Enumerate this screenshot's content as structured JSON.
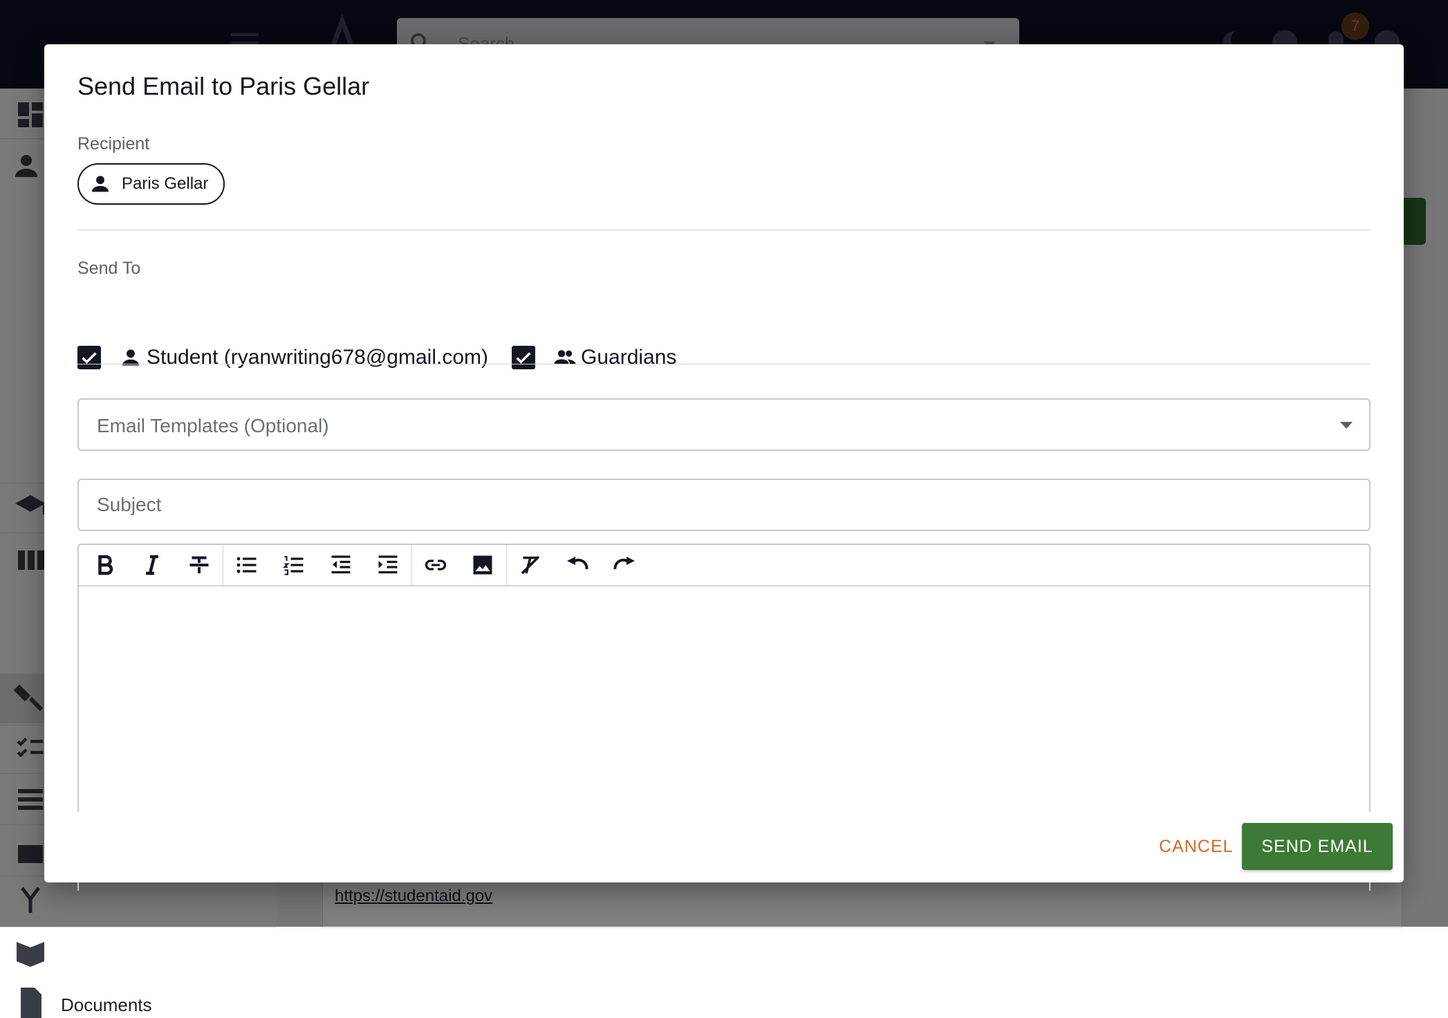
{
  "background": {
    "search_placeholder": "Search",
    "notification_count": "7",
    "sidebar_label": "Documents",
    "content_link": "https://studentaid.gov"
  },
  "modal": {
    "title": "Send Email to Paris Gellar",
    "recipient_label": "Recipient",
    "recipient_chip": "Paris Gellar",
    "send_to_label": "Send To",
    "student_option": "Student (ryanwriting678@gmail.com)",
    "guardians_option": "Guardians",
    "student_checked": true,
    "guardians_checked": true,
    "template_placeholder": "Email Templates (Optional)",
    "subject_placeholder": "Subject",
    "cancel_label": "CANCEL",
    "send_label": "SEND EMAIL"
  },
  "toolbar_icons": [
    "bold-icon",
    "italic-icon",
    "strikethrough-icon",
    "bullet-list-icon",
    "numbered-list-icon",
    "outdent-icon",
    "indent-icon",
    "link-icon",
    "image-icon",
    "clear-format-icon",
    "undo-icon",
    "redo-icon"
  ],
  "colors": {
    "primary_dark": "#141622",
    "cancel_orange": "#d06a20",
    "send_green": "#3d7a35",
    "topbar": "#0b1021"
  }
}
